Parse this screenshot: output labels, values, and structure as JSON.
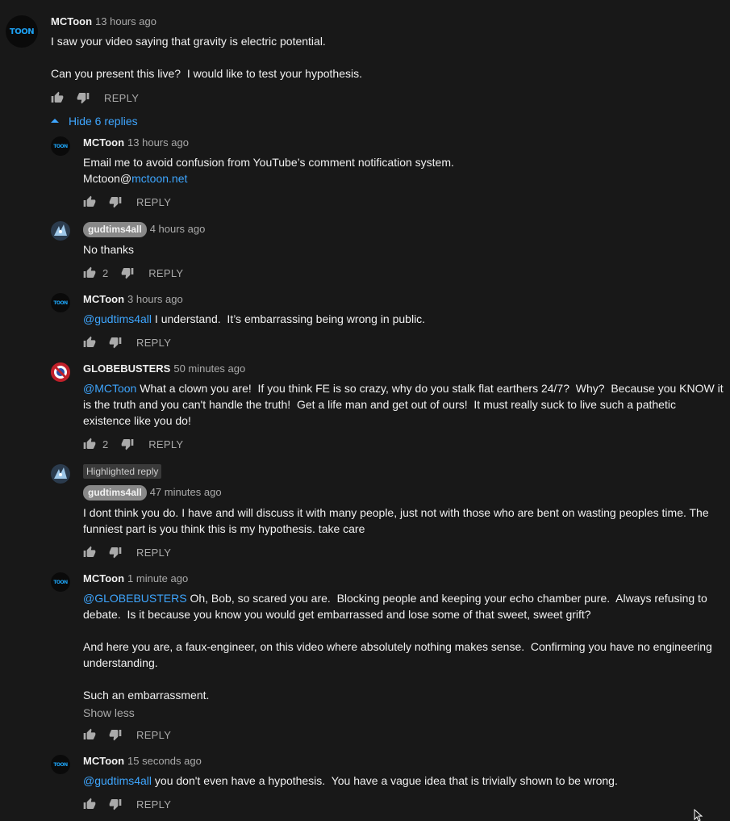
{
  "top_comment": {
    "author": "MCToon",
    "time": "13 hours ago",
    "avatar_text": "TOON",
    "text_line1": "I saw your video saying that gravity is electric potential.",
    "text_line2": "Can you present this live?  I would like to test your hypothesis.",
    "reply_label": "REPLY",
    "icon_like": "thumb-up-icon",
    "icon_dislike": "thumb-down-icon"
  },
  "replies_toggle": {
    "label": "Hide 6 replies",
    "icon": "caret-up-icon"
  },
  "replies": [
    {
      "author": "MCToon",
      "time": "13 hours ago",
      "avatar_text": "TOON",
      "text_line1": "Email me to avoid confusion from YouTube’s comment notification system.",
      "text_prefix": "Mctoon@",
      "link": "mctoon.net",
      "reply_label": "REPLY"
    },
    {
      "author": "gudtims4all",
      "time": "4 hours ago",
      "text": "No thanks",
      "likes": "2",
      "reply_label": "REPLY"
    },
    {
      "author": "MCToon",
      "time": "3 hours ago",
      "avatar_text": "TOON",
      "mention": "@gudtims4all",
      "text": " I understand.  It’s embarrassing being wrong in public.",
      "reply_label": "REPLY"
    },
    {
      "author": "GLOBEBUSTERS",
      "time": "50 minutes ago",
      "mention": "@MCToon",
      "text": " What a clown you are!  If you think FE is so crazy, why do you stalk flat earthers 24/7?  Why?  Because you KNOW it is the truth and you can't handle the truth!  Get a life man and get out of ours!  It must really suck to live such a pathetic existence like you do!",
      "likes": "2",
      "reply_label": "REPLY"
    },
    {
      "highlight": "Highlighted reply",
      "author": "gudtims4all",
      "time": "47 minutes ago",
      "text": "I dont think you do. I have and will discuss it with many people, just not with those who are bent on wasting peoples time. The funniest part is you think this is my hypothesis. take care",
      "reply_label": "REPLY"
    },
    {
      "author": "MCToon",
      "time": "1 minute ago",
      "avatar_text": "TOON",
      "mention": "@GLOBEBUSTERS",
      "text_p1": " Oh, Bob, so scared you are.  Blocking people and keeping your echo chamber pure.  Always refusing to debate.  Is it because you know you would get embarrassed and lose some of that sweet, sweet grift?",
      "text_p2": "And here you are, a faux-engineer, on this video where absolutely nothing makes sense.  Confirming you have no engineering understanding.",
      "text_p3": "Such an embarrassment.",
      "show_less": "Show less",
      "reply_label": "REPLY"
    },
    {
      "author": "MCToon",
      "time": "15 seconds ago",
      "avatar_text": "TOON",
      "mention": "@gudtims4all",
      "text": " you don't even have a hypothesis.  You have a vague idea that is trivially shown to be wrong.",
      "reply_label": "REPLY"
    }
  ],
  "colors": {
    "background": "#181818",
    "text": "#f1f1f1",
    "secondary": "#aaaaaa",
    "link": "#3ea6ff"
  }
}
